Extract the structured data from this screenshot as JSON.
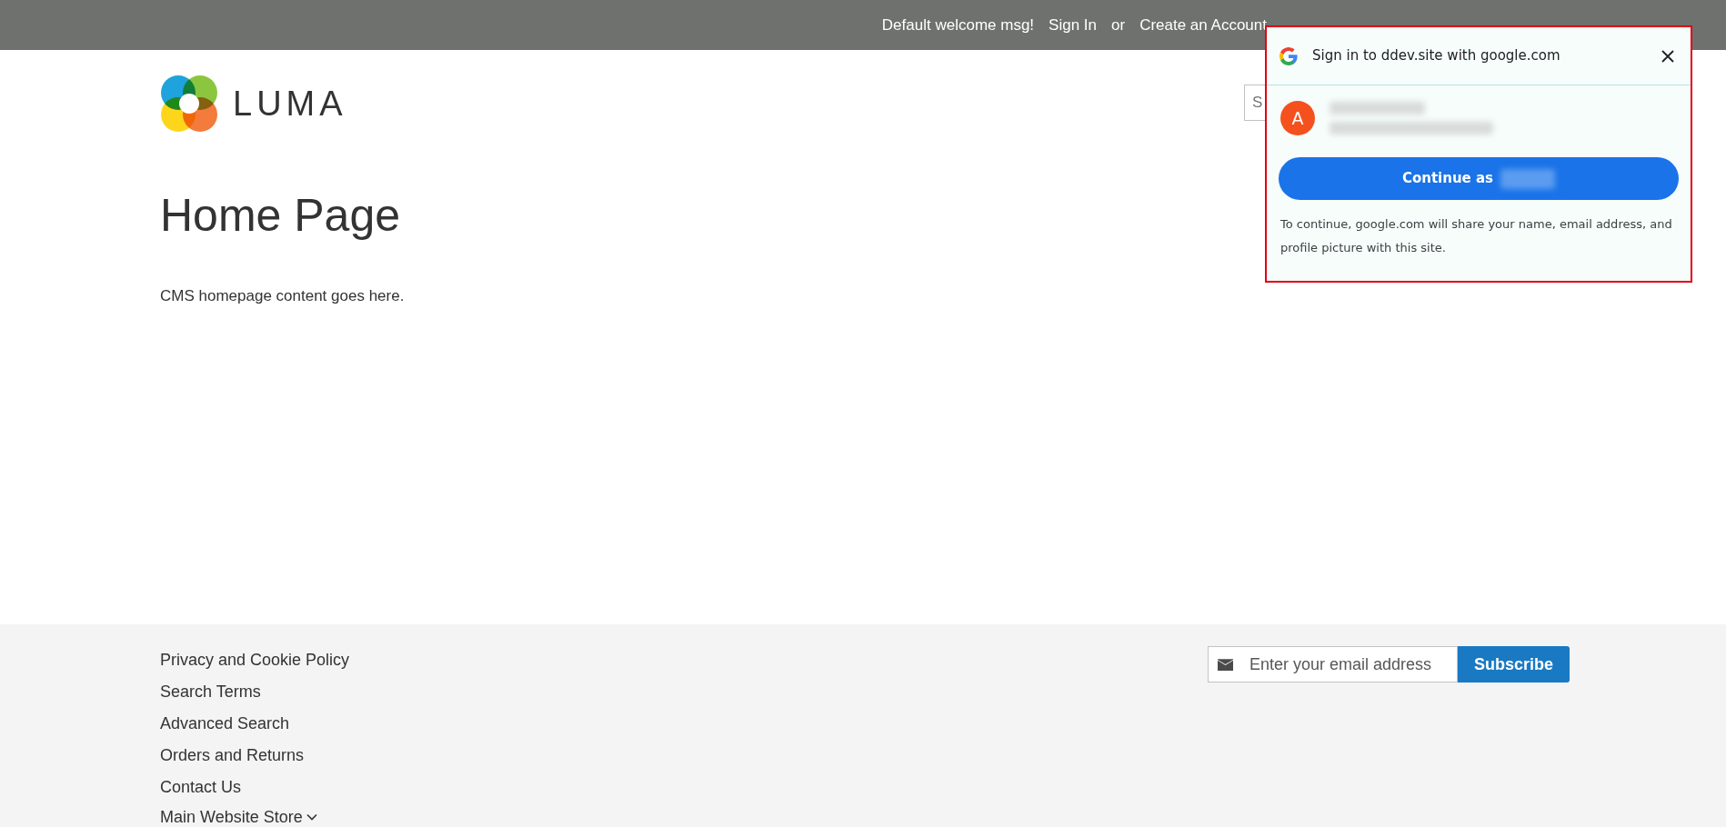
{
  "top_bar": {
    "welcome": "Default welcome msg!",
    "sign_in": "Sign In",
    "separator": "or",
    "create_account": "Create an Account"
  },
  "header": {
    "logo_text": "LUMA",
    "search": {
      "placeholder": "S"
    }
  },
  "page": {
    "title": "Home Page",
    "content": "CMS homepage content goes here."
  },
  "footer": {
    "links": [
      "Privacy and Cookie Policy",
      "Search Terms",
      "Advanced Search",
      "Orders and Returns",
      "Contact Us"
    ],
    "store_switcher": "Main Website Store",
    "newsletter": {
      "placeholder": "Enter your email address",
      "button": "Subscribe"
    }
  },
  "google_popup": {
    "title": "Sign in to ddev.site with google.com",
    "avatar_letter": "A",
    "button": "Continue as",
    "disclaimer": "To continue, google.com will share your name, email address, and profile picture with this site."
  }
}
